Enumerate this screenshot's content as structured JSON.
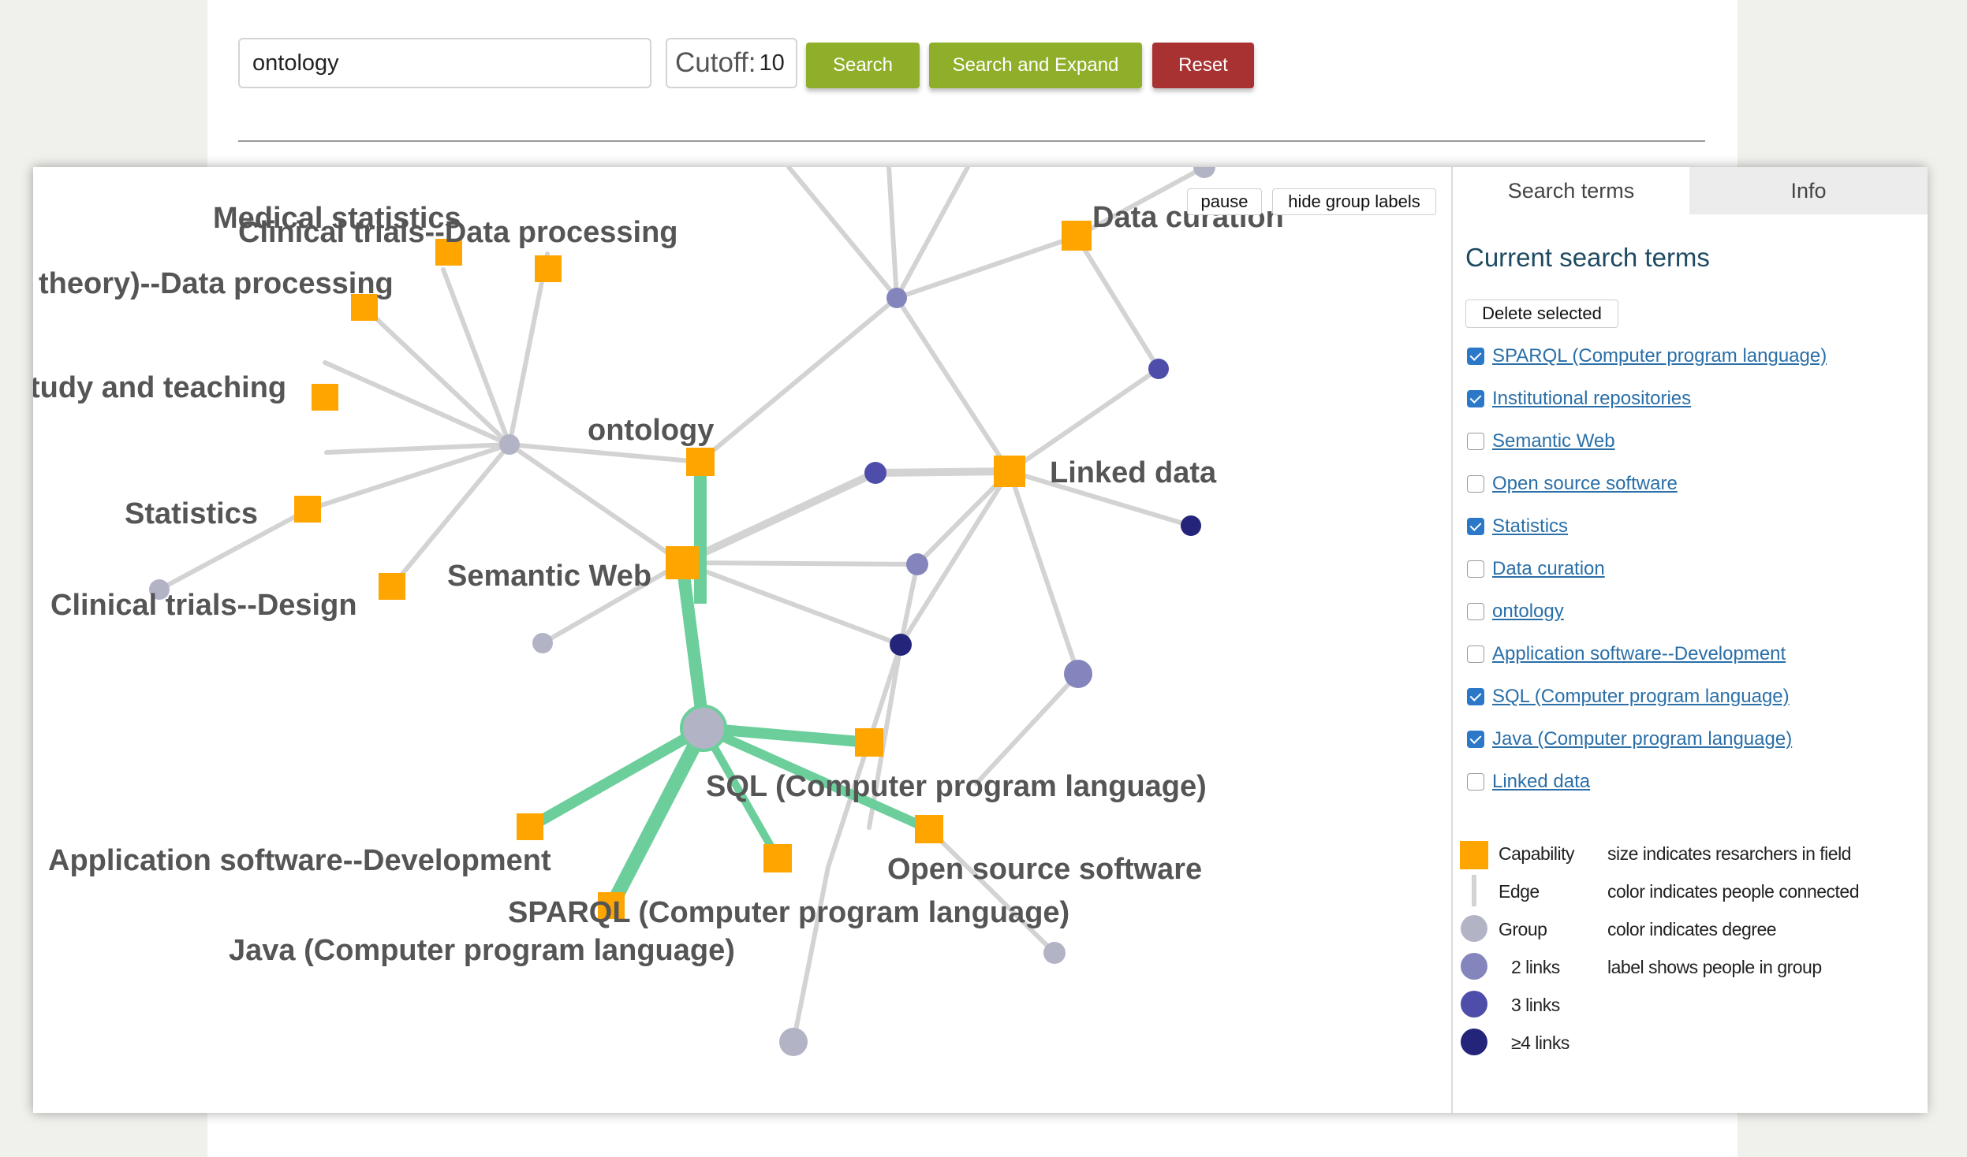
{
  "search": {
    "value": "ontology"
  },
  "cutoff": {
    "label": "Cutoff:",
    "value": "10"
  },
  "buttons": {
    "search": "Search",
    "search_expand": "Search and Expand",
    "reset": "Reset"
  },
  "graph": {
    "controls": {
      "pause": "pause",
      "hide_labels": "hide group labels"
    },
    "colors": {
      "capability": "#ffa500",
      "edge": "#d3d3d3",
      "highlight_edge": "#6ccf9b",
      "group": "#b3b3c6",
      "links_2": "#8585bd",
      "links_3": "#4e4eaa",
      "links_4plus": "#24247a"
    },
    "labels": {
      "medical_statistics": "Medical statistics",
      "clinical_trials_data": "Clinical trials--Data processing",
      "theory_data": "theory)--Data processing",
      "study_teaching": "tudy and teaching",
      "ontology": "ontology",
      "statistics": "Statistics",
      "clinical_trials_design": "Clinical trials--Design",
      "semantic_web": "Semantic Web",
      "data_curation": "Data curation",
      "linked_data": "Linked data",
      "sql": "SQL (Computer program language)",
      "app_software": "Application software--Development",
      "open_source": "Open source software",
      "sparql": "SPARQL (Computer program language)",
      "java": "Java (Computer program language)"
    }
  },
  "sidebar": {
    "tabs": {
      "search_terms": "Search terms",
      "info": "Info"
    },
    "title": "Current search terms",
    "delete_button": "Delete selected",
    "terms": [
      {
        "label": "SPARQL (Computer program language)",
        "checked": true
      },
      {
        "label": "Institutional repositories",
        "checked": true
      },
      {
        "label": "Semantic Web",
        "checked": false
      },
      {
        "label": "Open source software",
        "checked": false
      },
      {
        "label": "Statistics",
        "checked": true
      },
      {
        "label": "Data curation",
        "checked": false
      },
      {
        "label": "ontology",
        "checked": false
      },
      {
        "label": "Application software--Development",
        "checked": false
      },
      {
        "label": "SQL (Computer program language)",
        "checked": true
      },
      {
        "label": "Java (Computer program language)",
        "checked": true
      },
      {
        "label": "Linked data",
        "checked": false
      }
    ],
    "legend": {
      "capability": "Capability",
      "capability_desc": "size indicates resarchers in field",
      "edge": "Edge",
      "edge_desc": "color indicates people connected",
      "group": "Group",
      "group_desc": "color indicates degree",
      "links2": "2 links",
      "links2_desc": "label shows people in group",
      "links3": "3 links",
      "links4": "≥4 links"
    }
  }
}
